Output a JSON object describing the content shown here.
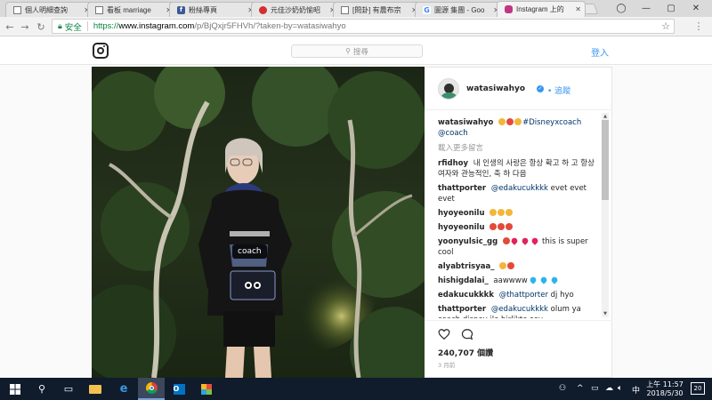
{
  "browser": {
    "tabs": [
      {
        "label": "個人明細查詢",
        "favicon": "doc"
      },
      {
        "label": "看板 marriage",
        "favicon": "doc"
      },
      {
        "label": "粉絲專頁",
        "favicon": "fb"
      },
      {
        "label": "元佳沙奶奶愉昭",
        "favicon": "red"
      },
      {
        "label": "[問卦] 有農布宗",
        "favicon": "doc"
      },
      {
        "label": "圖源 集團 - Goo",
        "favicon": "g"
      },
      {
        "label": "Instagram 上的",
        "favicon": "ig"
      }
    ],
    "secure_label": "安全",
    "url": {
      "scheme": "https://",
      "host": "www.instagram.com",
      "rest": "/p/BjQxjr5FHVh/?taken-by=watasiwahyo"
    }
  },
  "instagram": {
    "search_placeholder": "搜尋",
    "login_label": "登入",
    "photo_tag": "coach",
    "post": {
      "username": "watasiwahyo",
      "follow_label": "追蹤",
      "caption_user": "watasiwahyo",
      "caption_text": "#Disneyxcoach",
      "caption_mention": "@coach",
      "load_more": "載入更多留言",
      "comments": [
        {
          "user": "rfidhoy",
          "text": "내 인생의 사랑은 항상 확고 하 고 항상 여자와 관능적인, 축 하 다음"
        },
        {
          "user": "thattporter",
          "mention": "@edakucukkkk",
          "text": "evet evet evet"
        },
        {
          "user": "hyoyeonilu",
          "text": ""
        },
        {
          "user": "hyoyeonilu",
          "text": ""
        },
        {
          "user": "yoonyulsic_gg",
          "text": "this is super cool"
        },
        {
          "user": "alyabtrisyaa_",
          "text": ""
        },
        {
          "user": "hishigdalai_",
          "text": "aawwww"
        },
        {
          "user": "edakucukkkk",
          "mention": "@thattporter",
          "text": "dj hyo"
        },
        {
          "user": "thattporter",
          "mention": "@edakucukkkk",
          "text": "olum ya coach disney ile birlikte şey yaptiklarından beri daha çok seviyorum"
        }
      ],
      "likes": "240,707 個讚",
      "time": "3 月前"
    }
  },
  "taskbar": {
    "clock_time": "上午 11:57",
    "clock_date": "2018/5/30",
    "notification_count": "20",
    "lang": "中"
  },
  "colors": {
    "accent": "#3897f0",
    "secure_green": "#0b8043",
    "taskbar": "#101b2c"
  }
}
